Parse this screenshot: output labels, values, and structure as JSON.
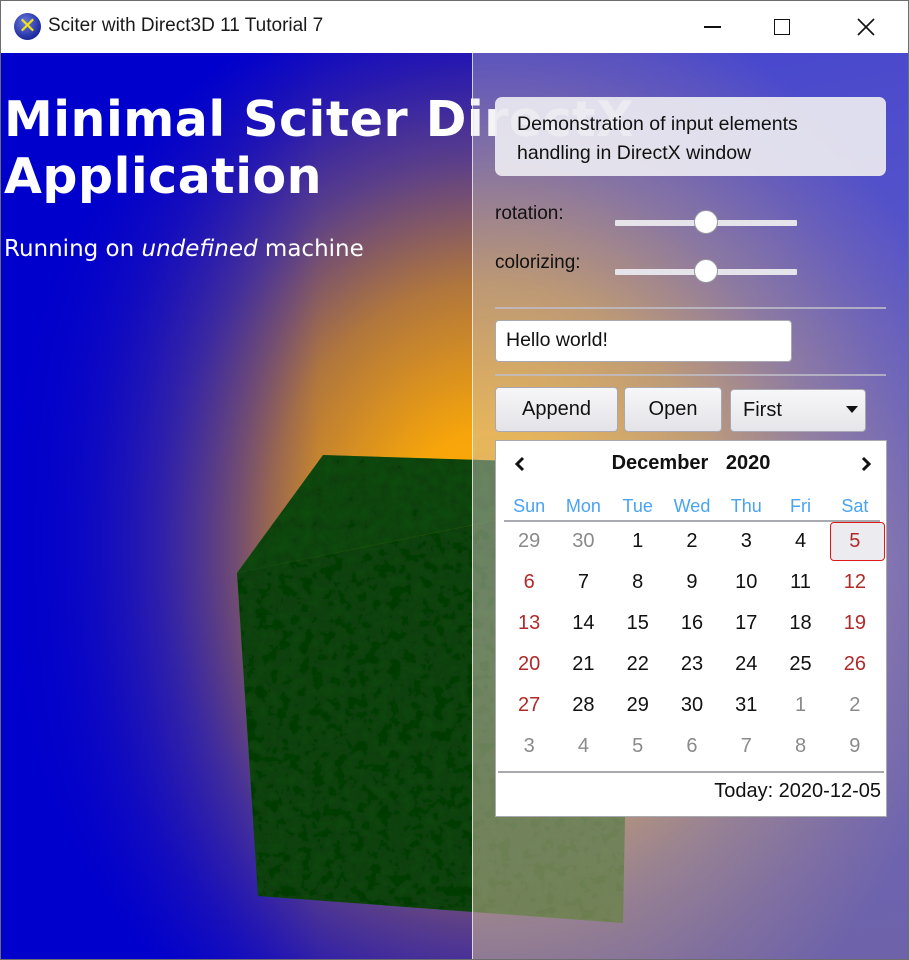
{
  "window": {
    "title": "Sciter with Direct3D 11 Tutorial 7",
    "controls": {
      "minimize": "minimize",
      "maximize": "maximize",
      "close": "close"
    }
  },
  "scene": {
    "heading_line1": "Minimal Sciter DirectX",
    "heading_line2": "Application",
    "sub_prefix": "Running on ",
    "sub_em": "undefined",
    "sub_suffix": " machine",
    "colors": {
      "bg_blue": "#0000cc",
      "bg_orange": "#ffaa00",
      "cube_green": "#0b4d0b"
    }
  },
  "panel": {
    "info": "Demonstration of input elements handling in DirectX window",
    "rotation_label": "rotation:",
    "rotation_value": 0.5,
    "colorizing_label": "colorizing:",
    "colorizing_value": 0.5,
    "text_input_value": "Hello world!",
    "append_label": "Append",
    "open_label": "Open",
    "select_value": "First"
  },
  "calendar": {
    "month": "December",
    "year": "2020",
    "prev": "‹",
    "next": "›",
    "weekdays": [
      "Sun",
      "Mon",
      "Tue",
      "Wed",
      "Thu",
      "Fri",
      "Sat"
    ],
    "weeks": [
      [
        {
          "d": "29",
          "t": "other"
        },
        {
          "d": "30",
          "t": "other"
        },
        {
          "d": "1",
          "t": ""
        },
        {
          "d": "2",
          "t": ""
        },
        {
          "d": "3",
          "t": ""
        },
        {
          "d": "4",
          "t": ""
        },
        {
          "d": "5",
          "t": "weekend today"
        }
      ],
      [
        {
          "d": "6",
          "t": "weekend"
        },
        {
          "d": "7",
          "t": ""
        },
        {
          "d": "8",
          "t": ""
        },
        {
          "d": "9",
          "t": ""
        },
        {
          "d": "10",
          "t": ""
        },
        {
          "d": "11",
          "t": ""
        },
        {
          "d": "12",
          "t": "weekend"
        }
      ],
      [
        {
          "d": "13",
          "t": "weekend"
        },
        {
          "d": "14",
          "t": ""
        },
        {
          "d": "15",
          "t": ""
        },
        {
          "d": "16",
          "t": ""
        },
        {
          "d": "17",
          "t": ""
        },
        {
          "d": "18",
          "t": ""
        },
        {
          "d": "19",
          "t": "weekend"
        }
      ],
      [
        {
          "d": "20",
          "t": "weekend"
        },
        {
          "d": "21",
          "t": ""
        },
        {
          "d": "22",
          "t": ""
        },
        {
          "d": "23",
          "t": ""
        },
        {
          "d": "24",
          "t": ""
        },
        {
          "d": "25",
          "t": ""
        },
        {
          "d": "26",
          "t": "weekend"
        }
      ],
      [
        {
          "d": "27",
          "t": "weekend"
        },
        {
          "d": "28",
          "t": ""
        },
        {
          "d": "29",
          "t": ""
        },
        {
          "d": "30",
          "t": ""
        },
        {
          "d": "31",
          "t": ""
        },
        {
          "d": "1",
          "t": "other"
        },
        {
          "d": "2",
          "t": "other"
        }
      ],
      [
        {
          "d": "3",
          "t": "other"
        },
        {
          "d": "4",
          "t": "other"
        },
        {
          "d": "5",
          "t": "other"
        },
        {
          "d": "6",
          "t": "other"
        },
        {
          "d": "7",
          "t": "other"
        },
        {
          "d": "8",
          "t": "other"
        },
        {
          "d": "9",
          "t": "other"
        }
      ]
    ],
    "today_text": "Today: 2020-12-05",
    "colors": {
      "weekday_header": "#4aa3f0",
      "weekend": "#b02a2a",
      "other_month": "#8a8a8a",
      "today_border": "#e01818"
    }
  }
}
